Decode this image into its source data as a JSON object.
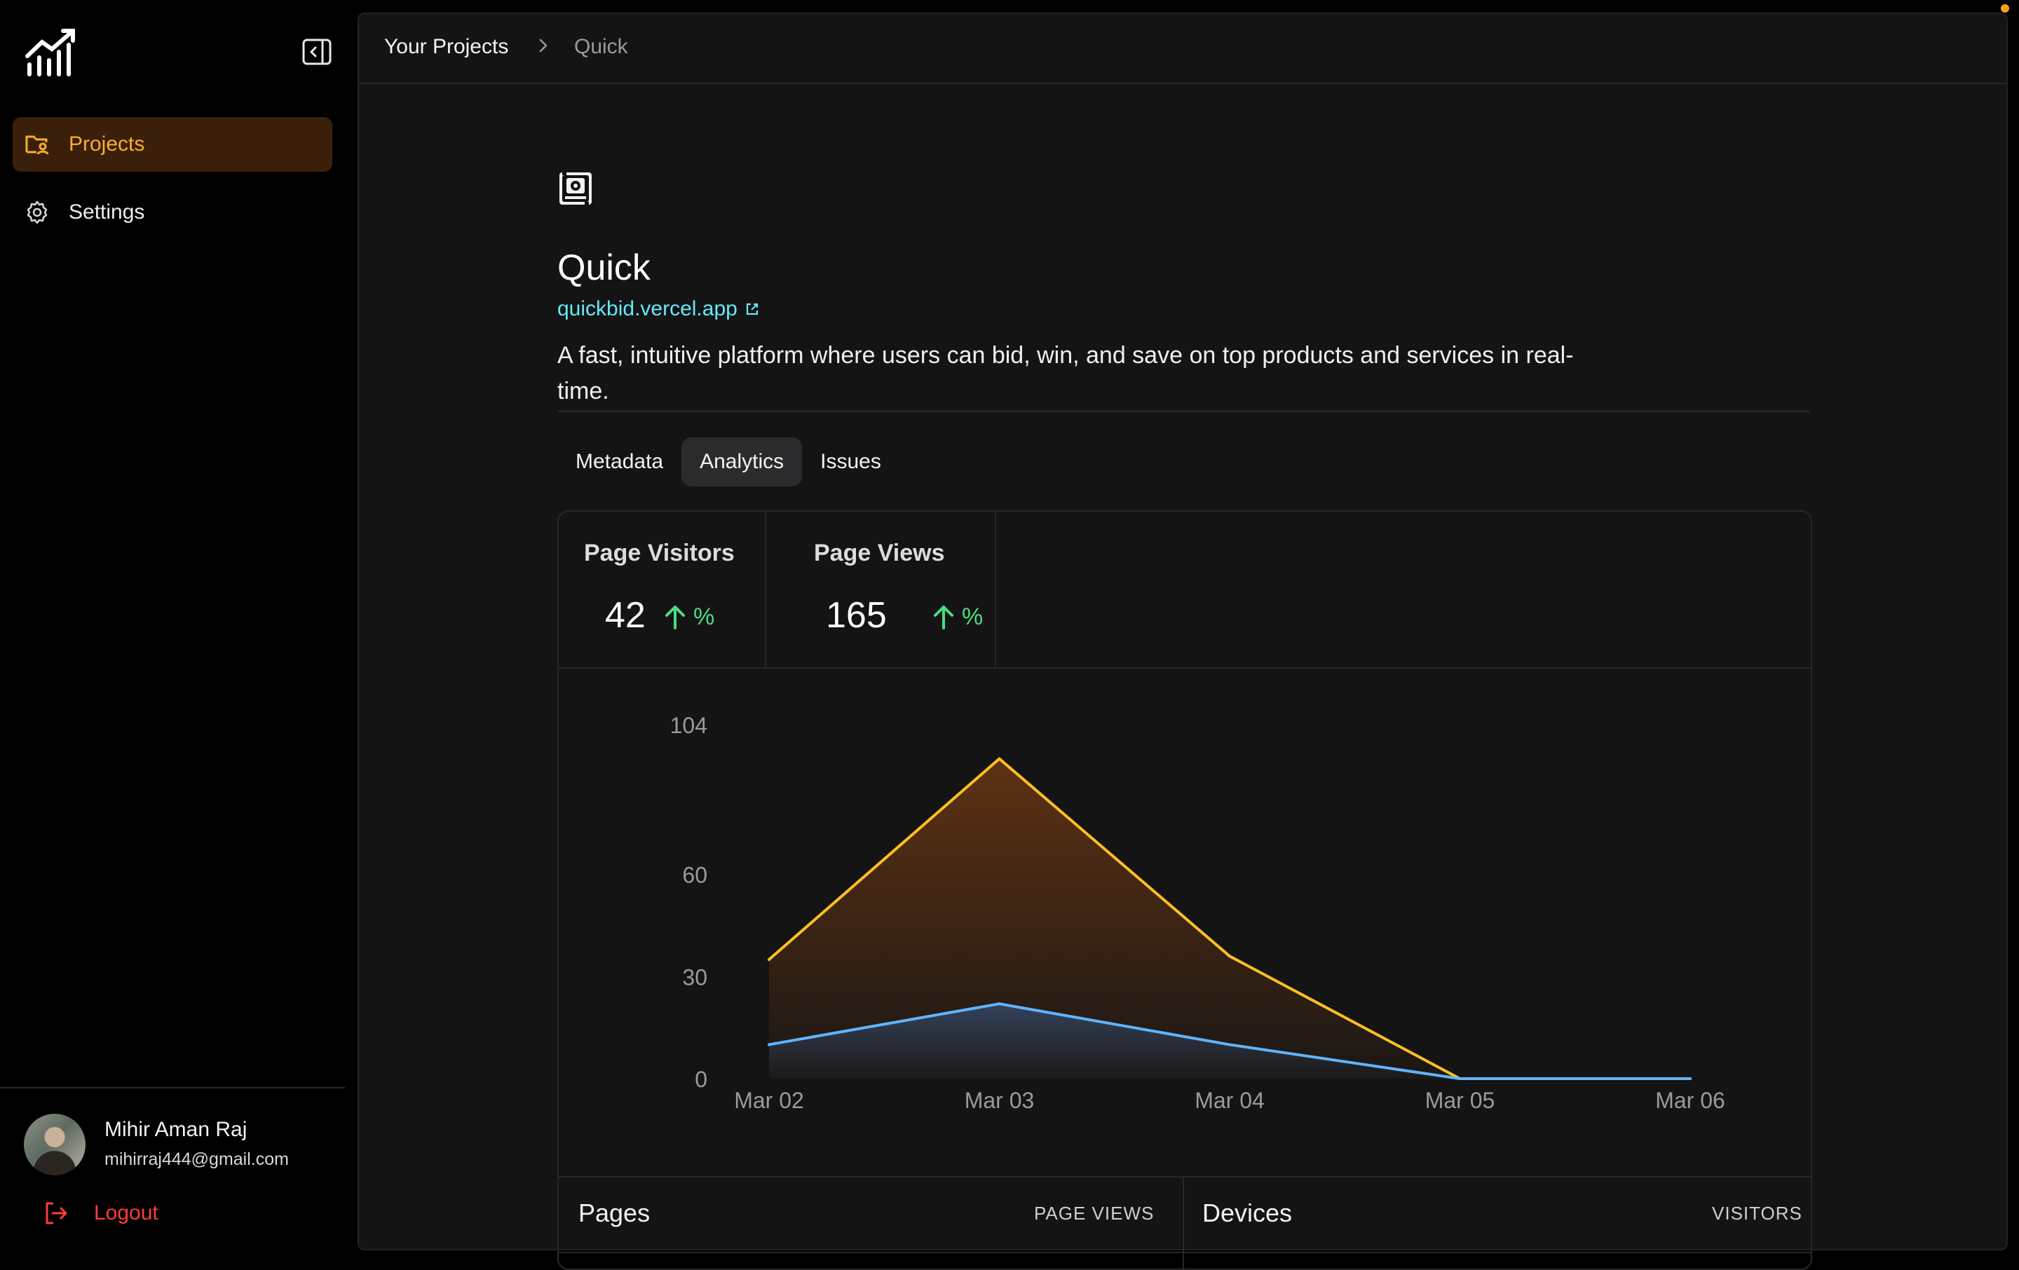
{
  "sidebar": {
    "nav": [
      {
        "label": "Projects",
        "icon": "folder-user-icon",
        "active": true
      },
      {
        "label": "Settings",
        "icon": "gear-icon",
        "active": false
      }
    ],
    "user": {
      "name": "Mihir Aman Raj",
      "email": "mihirraj444@gmail.com"
    },
    "logout_label": "Logout"
  },
  "breadcrumb": {
    "root": "Your Projects",
    "current": "Quick"
  },
  "project": {
    "title": "Quick",
    "url": "quickbid.vercel.app",
    "description": "A fast, intuitive platform where users can bid, win, and save on top products and services in real-time."
  },
  "tabs": [
    {
      "label": "Metadata",
      "active": false
    },
    {
      "label": "Analytics",
      "active": true
    },
    {
      "label": "Issues",
      "active": false
    }
  ],
  "stats": {
    "visitors": {
      "label": "Page Visitors",
      "value": "42",
      "change": "%"
    },
    "views": {
      "label": "Page Views",
      "value": "165",
      "change": "%"
    }
  },
  "colors": {
    "accent": "#fbad2c",
    "views_line": "#fbbf24",
    "visitors_line": "#60b4ff",
    "trend_up": "#4ade80",
    "logout": "#ff3b3b",
    "link": "#67e8f9"
  },
  "chart_data": {
    "type": "area",
    "categories": [
      "Mar 02",
      "Mar 03",
      "Mar 04",
      "Mar 05",
      "Mar 06"
    ],
    "yticks": [
      0,
      30,
      60,
      104
    ],
    "ylim": [
      0,
      104
    ],
    "grid": false,
    "series": [
      {
        "key": "views",
        "values": [
          35,
          94,
          36,
          0,
          0
        ]
      },
      {
        "key": "visitors",
        "values": [
          10,
          22,
          10,
          0,
          0
        ]
      }
    ]
  },
  "panels": {
    "pages": {
      "title": "Pages",
      "column": "PAGE VIEWS"
    },
    "devices": {
      "title": "Devices",
      "column": "VISITORS"
    }
  }
}
